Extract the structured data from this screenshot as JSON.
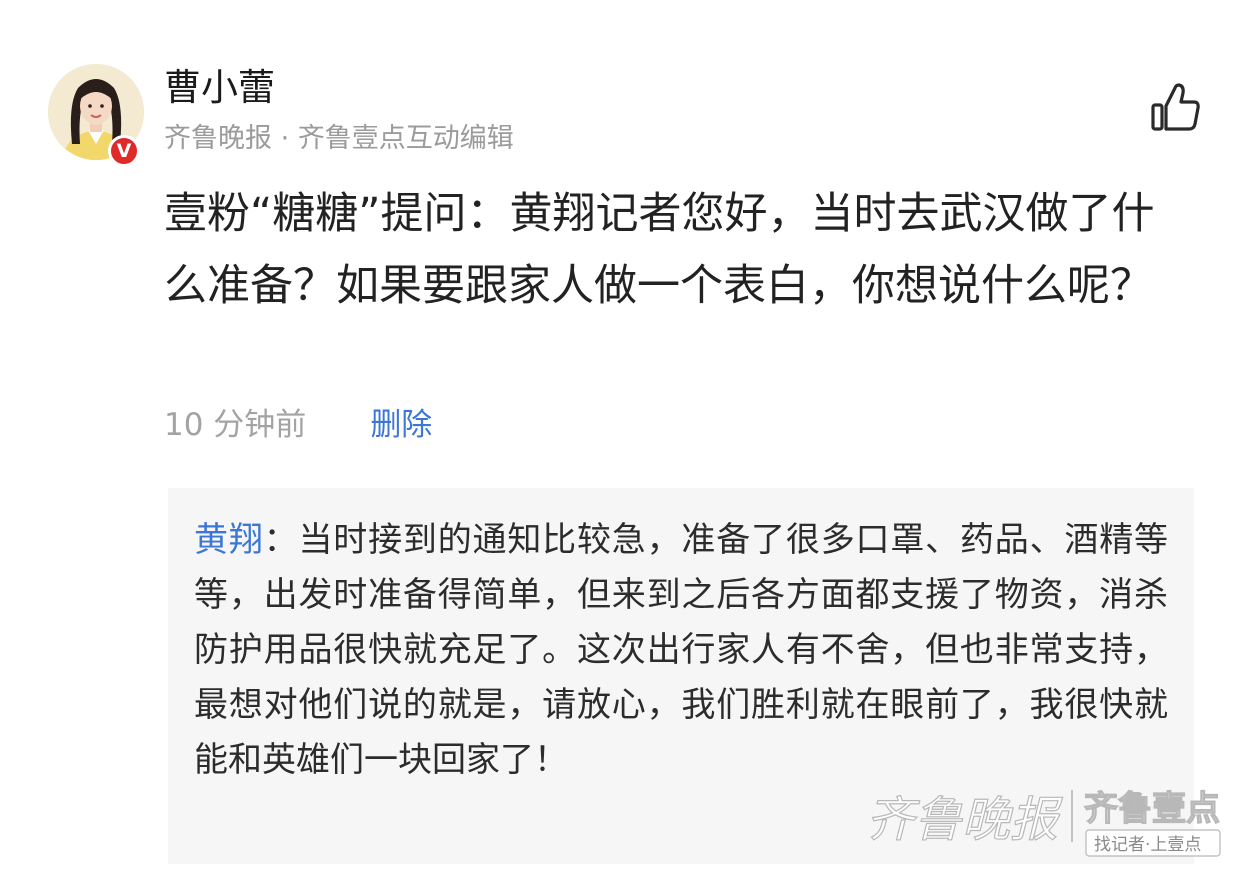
{
  "author": {
    "name": "曹小蕾",
    "meta": "齐鲁晚报 · 齐鲁壹点互动编辑",
    "verified_badge": "V"
  },
  "question": {
    "text": "壹粉“糖糖”提问：黄翔记者您好，当时去武汉做了什么准备？如果要跟家人做一个表白，你想说什么呢？"
  },
  "meta": {
    "timestamp": "10 分钟前",
    "delete_label": "删除"
  },
  "reply": {
    "author": "黄翔",
    "separator": "：",
    "text": "当时接到的通知比较急，准备了很多口罩、药品、酒精等等，出发时准备得简单，但来到之后各方面都支援了物资，消杀防护用品很快就充足了。这次出行家人有不舍，但也非常支持，最想对他们说的就是，请放心，我们胜利就在眼前了，我很快就能和英雄们一块回家了！"
  },
  "watermark": {
    "brand": "齐鲁晚报",
    "logo": "齐鲁壹点",
    "slogan": "找记者·上壹点"
  },
  "colors": {
    "link": "#3d77d6",
    "badge": "#e02a2a",
    "reply_bg": "#f6f6f6",
    "muted_text": "#9b9b9b"
  },
  "icons": {
    "like": "thumbs-up-icon",
    "verified": "verified-v-icon"
  }
}
